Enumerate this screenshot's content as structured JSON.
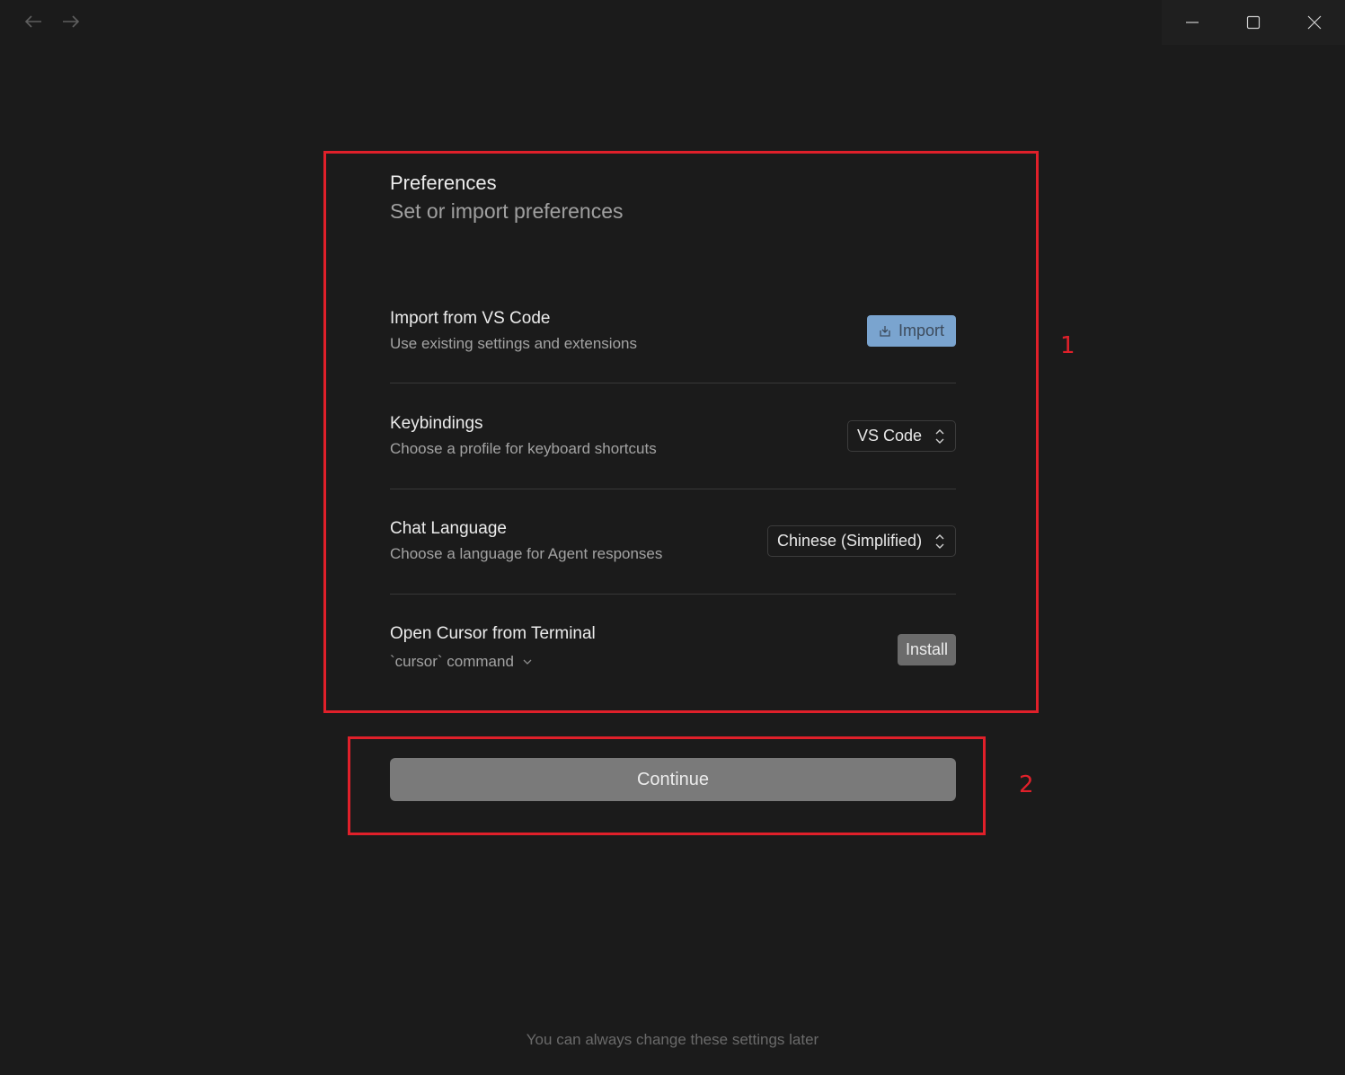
{
  "titlebar": {
    "back_icon": "arrow-left-icon",
    "forward_icon": "arrow-right-icon",
    "minimize_icon": "minimize-icon",
    "maximize_icon": "maximize-icon",
    "close_icon": "close-icon"
  },
  "header": {
    "title": "Preferences",
    "subtitle": "Set or import preferences"
  },
  "settings": {
    "import": {
      "title": "Import from VS Code",
      "description": "Use existing settings and extensions",
      "button_label": "Import",
      "button_icon": "import-icon"
    },
    "keybindings": {
      "title": "Keybindings",
      "description": "Choose a profile for keyboard shortcuts",
      "selected": "VS Code"
    },
    "chat_language": {
      "title": "Chat Language",
      "description": "Choose a language for Agent responses",
      "selected": "Chinese (Simplified)"
    },
    "terminal": {
      "title": "Open Cursor from Terminal",
      "command_label": "`cursor` command",
      "button_label": "Install"
    }
  },
  "continue_label": "Continue",
  "footer": "You can always change these settings later",
  "annotations": [
    "1",
    "2"
  ],
  "colors": {
    "background": "#1b1b1b",
    "accent": "#7aa4cf",
    "annotation": "#e0202a"
  }
}
